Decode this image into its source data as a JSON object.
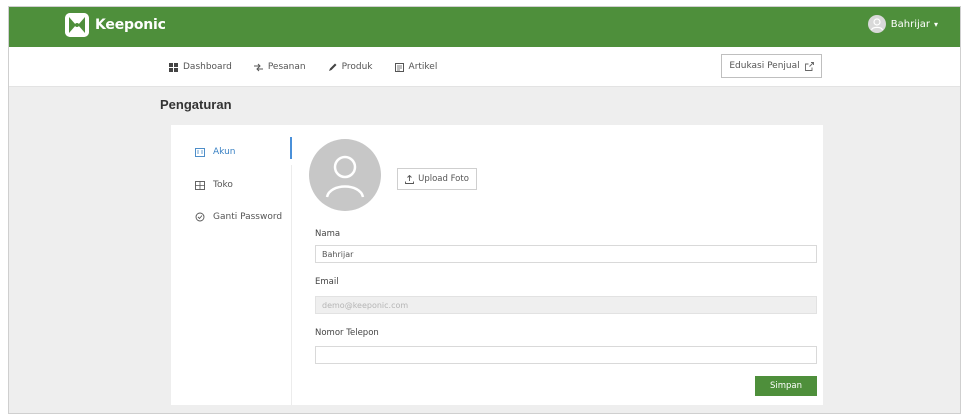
{
  "app": {
    "brand": "Keeponic",
    "user_name": "Bahrijar",
    "user_caret": "▾"
  },
  "nav": {
    "items": [
      {
        "label": "Dashboard",
        "icon": "dashboard-icon"
      },
      {
        "label": "Pesanan",
        "icon": "orders-icon"
      },
      {
        "label": "Produk",
        "icon": "pencil-icon"
      },
      {
        "label": "Artikel",
        "icon": "article-icon"
      }
    ],
    "edu_button": "Edukasi Penjual"
  },
  "page": {
    "title": "Pengaturan"
  },
  "settings_menu": [
    {
      "label": "Akun",
      "icon": "account-icon",
      "active": true
    },
    {
      "label": "Toko",
      "icon": "store-icon",
      "active": false
    },
    {
      "label": "Ganti Password",
      "icon": "password-icon",
      "active": false
    }
  ],
  "profile": {
    "upload_label": "Upload Foto",
    "name_label": "Nama",
    "name_value": "Bahrijar",
    "email_label": "Email",
    "email_value": "demo@keeponic.com",
    "phone_label": "Nomor Telepon",
    "phone_value": "",
    "save_label": "Simpan"
  },
  "colors": {
    "brand_green": "#4e8f3b",
    "active_blue": "#3b82c4"
  }
}
